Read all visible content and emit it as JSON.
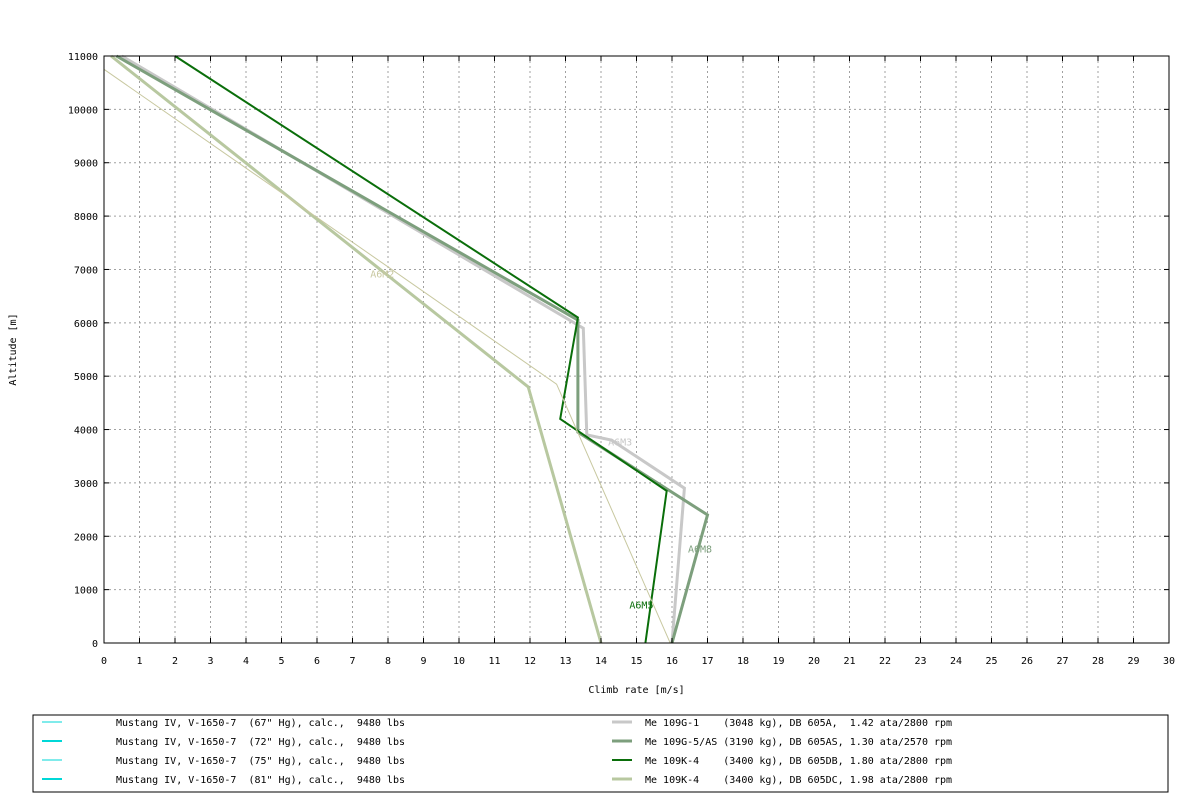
{
  "chart_data": {
    "type": "line",
    "title": "",
    "xlabel": "Climb rate [m/s]",
    "ylabel": "Altitude [m]",
    "xlim": [
      0,
      30
    ],
    "ylim": [
      0,
      11000
    ],
    "x_ticks": [
      "0",
      "1",
      "2",
      "3",
      "4",
      "5",
      "6",
      "7",
      "8",
      "9",
      "10",
      "11",
      "12",
      "13",
      "14",
      "15",
      "16",
      "17",
      "18",
      "19",
      "20",
      "21",
      "22",
      "23",
      "24",
      "25",
      "26",
      "27",
      "28",
      "29",
      "30"
    ],
    "y_ticks": [
      "0",
      "1000",
      "2000",
      "3000",
      "4000",
      "5000",
      "6000",
      "7000",
      "8000",
      "9000",
      "10000",
      "11000"
    ],
    "grid": true,
    "legend_position": "bottom",
    "series": [
      {
        "name": "Mustang IV, V-1650-7  (67\" Hg), calc.,  9480 lbs",
        "color": "#00d7d7",
        "width": 1,
        "points": []
      },
      {
        "name": "Mustang IV, V-1650-7  (72\" Hg), calc.,  9480 lbs",
        "color": "#00d7d7",
        "width": 2,
        "points": []
      },
      {
        "name": "Mustang IV, V-1650-7  (75\" Hg), calc.,  9480 lbs",
        "color": "#00d7d7",
        "width": 1,
        "points": []
      },
      {
        "name": "Mustang IV, V-1650-7  (81\" Hg), calc.,  9480 lbs",
        "color": "#00d7d7",
        "width": 2,
        "points": []
      },
      {
        "name": "Me 109G-1    (3048 kg), DB 605A,  1.42 ata/2800 rpm",
        "color": "#c8c8c8",
        "width": 3,
        "points": [
          [
            16.0,
            0
          ],
          [
            16.35,
            2900
          ],
          [
            14.3,
            3800
          ],
          [
            13.6,
            3900
          ],
          [
            13.5,
            5900
          ],
          [
            0.5,
            11000
          ]
        ]
      },
      {
        "name": "Me 109G-5/AS (3190 kg), DB 605AS, 1.30 ata/2570 rpm",
        "color": "#7d9f7d",
        "width": 3,
        "points": [
          [
            16.0,
            0
          ],
          [
            17.0,
            2400
          ],
          [
            13.35,
            3950
          ],
          [
            13.35,
            6050
          ],
          [
            0.35,
            11000
          ]
        ]
      },
      {
        "name": "Me 109K-4    (3400 kg), DB 605DB, 1.80 ata/2800 rpm",
        "color": "#0a6e0a",
        "width": 2,
        "points": [
          [
            15.25,
            0
          ],
          [
            15.85,
            2850
          ],
          [
            12.85,
            4200
          ],
          [
            13.35,
            6100
          ],
          [
            2.0,
            11000
          ]
        ]
      },
      {
        "name": "Me 109K-4    (3400 kg), DB 605DC, 1.98 ata/2800 rpm",
        "color": "#b8c8a0",
        "width": 3,
        "points": [
          [
            14.0,
            0
          ],
          [
            11.95,
            4800
          ],
          [
            0.2,
            11000
          ]
        ]
      },
      {
        "name": "",
        "color": "#c8c8a0",
        "width": 1,
        "legend": false,
        "points": [
          [
            15.95,
            0
          ],
          [
            12.75,
            4850
          ],
          [
            0,
            10750
          ]
        ]
      }
    ],
    "annotations": [
      {
        "text": "A6M2",
        "x": 7.5,
        "y": 6850,
        "color": "#c8c8a0"
      },
      {
        "text": "A6M3",
        "x": 14.2,
        "y": 3700,
        "color": "#c8c8c8"
      },
      {
        "text": "A6M8",
        "x": 16.45,
        "y": 1700,
        "color": "#7d9f7d"
      },
      {
        "text": "A6M5",
        "x": 14.8,
        "y": 650,
        "color": "#0a6e0a"
      }
    ]
  }
}
